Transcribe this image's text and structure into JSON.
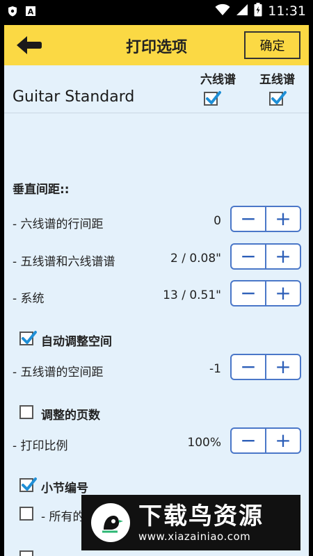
{
  "status_bar": {
    "time": "11:31",
    "left_icons": [
      "shield-icon",
      "a-icon"
    ],
    "right_icons": [
      "wifi-icon",
      "signal-icon",
      "battery-icon"
    ]
  },
  "app_bar": {
    "title": "打印选项",
    "confirm_label": "确定"
  },
  "columns": {
    "tab": "六线谱",
    "staff": "五线谱"
  },
  "track": {
    "name": "Guitar Standard",
    "tab_checked": true,
    "staff_checked": true
  },
  "vertical_spacing": {
    "header": "垂直间距::",
    "rows": [
      {
        "label": "- 六线谱的行间距",
        "value": "0"
      },
      {
        "label": "- 五线谱和六线谱谱",
        "value": "2 / 0.08\""
      },
      {
        "label": "- 系统",
        "value": "13 / 0.51\""
      }
    ]
  },
  "auto_space": {
    "label": "自动调整空间",
    "checked": true,
    "row": {
      "label": "- 五线谱的空间距",
      "value": "-1"
    }
  },
  "fit_pages": {
    "label": "调整的页数",
    "checked": false,
    "row": {
      "label": "- 打印比例",
      "value": "100%"
    }
  },
  "bar_numbers": {
    "label": "小节编号",
    "checked": true,
    "sub_label": "- 所有的",
    "sub_checked": false
  },
  "stepper": {
    "minus": "−",
    "plus": "+"
  },
  "watermark": {
    "cn": "下载鸟资源",
    "url": "www.xiazainiao.com"
  }
}
